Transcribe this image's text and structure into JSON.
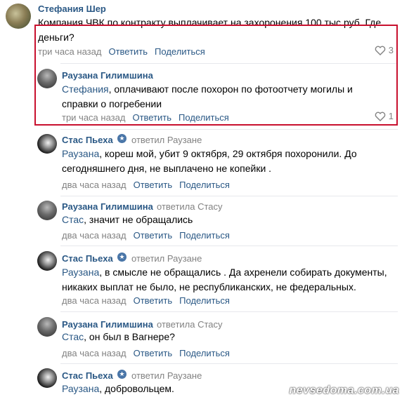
{
  "colors": {
    "link": "#2a5885",
    "muted": "#828282",
    "highlight_border": "#c8102e"
  },
  "actions": {
    "reply": "Ответить",
    "share": "Поделиться"
  },
  "comments": [
    {
      "author": "Стефания Шер",
      "text": "Компания ЧВК по контракту выплачивает на захоронения 100 тыс руб. Где деньги?",
      "time": "три часа назад",
      "likes": "3"
    },
    {
      "author": "Раузана Гилимшина",
      "addressee": "Стефания",
      "text": ", оплачивают после похорон по фотоотчету могилы и справки о погребении",
      "time": "три часа назад",
      "likes": "1"
    },
    {
      "author": "Стас Пьеха",
      "reply_to": "ответил Раузане",
      "addressee": "Раузана",
      "text": ", кореш мой, убит 9 октября, 29 октября похоронили. До сегодняшнего дня, не выплачено не копейки .",
      "time": "два часа назад"
    },
    {
      "author": "Раузана Гилимшина",
      "reply_to": "ответила Стасу",
      "addressee": "Стас",
      "text": ", значит не обращались",
      "time": "два часа назад"
    },
    {
      "author": "Стас Пьеха",
      "reply_to": "ответил Раузане",
      "addressee": "Раузана",
      "text": ", в смысле не обращались . Да ахренели собирать документы, никаких выплат не было, не республиканских, не федеральных.",
      "time": "два часа назад"
    },
    {
      "author": "Раузана Гилимшина",
      "reply_to": "ответила Стасу",
      "addressee": "Стас",
      "text": ", он был в Вагнере?",
      "time": "два часа назад"
    },
    {
      "author": "Стас Пьеха",
      "reply_to": "ответил Раузане",
      "addressee": "Раузана",
      "text": ", добровольцем.",
      "time": ""
    }
  ],
  "watermark": "nevsedoma.com.ua"
}
